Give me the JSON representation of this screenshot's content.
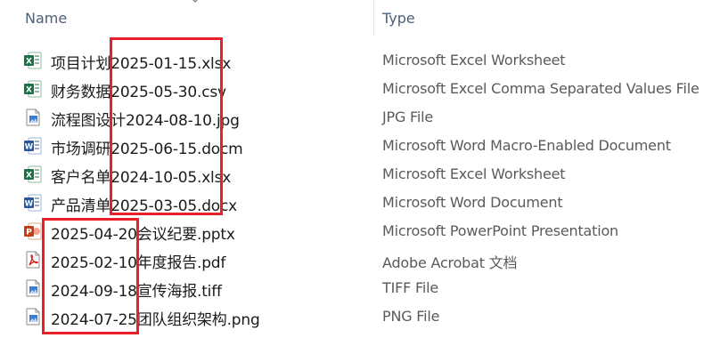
{
  "columns": {
    "name": "Name",
    "type": "Type"
  },
  "files": [
    {
      "name": "项目计划2025-01-15.xlsx",
      "type": "Microsoft Excel Worksheet",
      "icon": "excel-icon"
    },
    {
      "name": "财务数据2025-05-30.csv",
      "type": "Microsoft Excel Comma Separated Values File",
      "icon": "excel-csv-icon"
    },
    {
      "name": "流程图设计2024-08-10.jpg",
      "type": "JPG File",
      "icon": "image-file-icon"
    },
    {
      "name": "市场调研2025-06-15.docm",
      "type": "Microsoft Word Macro-Enabled Document",
      "icon": "word-icon"
    },
    {
      "name": "客户名单2024-10-05.xlsx",
      "type": "Microsoft Excel Worksheet",
      "icon": "excel-icon"
    },
    {
      "name": "产品清单2025-03-05.docx",
      "type": "Microsoft Word Document",
      "icon": "word-icon"
    },
    {
      "name": "2025-04-20会议纪要.pptx",
      "type": "Microsoft PowerPoint Presentation",
      "icon": "powerpoint-icon"
    },
    {
      "name": "2025-02-10年度报告.pdf",
      "type": "Adobe Acrobat 文档",
      "icon": "pdf-icon"
    },
    {
      "name": "2024-09-18宣传海报.tiff",
      "type": "TIFF File",
      "icon": "image-file-icon"
    },
    {
      "name": "2024-07-25团队组织架构.png",
      "type": "PNG File",
      "icon": "image-file-icon"
    }
  ],
  "colors": {
    "header_text": "#4c607a",
    "highlight": "#e8202a",
    "excel": "#1d7044",
    "word": "#2b579a",
    "powerpoint": "#c43e1c",
    "pdf": "#d61e1e",
    "image": "#3a7bd5"
  }
}
